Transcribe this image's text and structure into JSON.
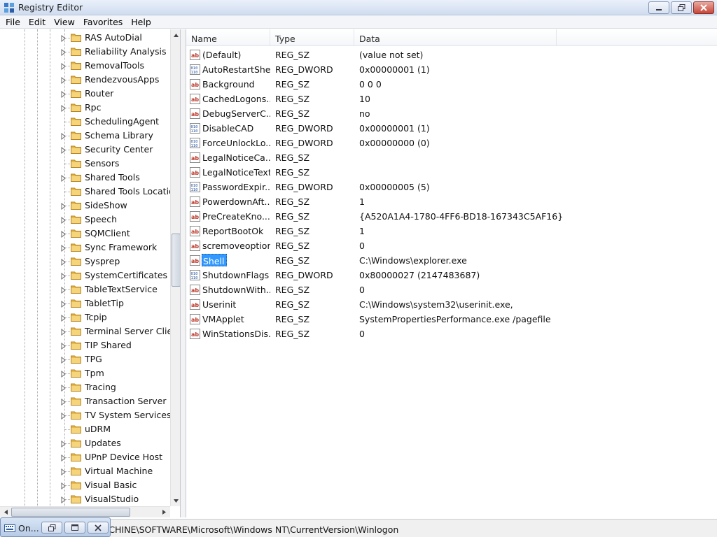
{
  "window": {
    "title": "Registry Editor"
  },
  "menu": [
    "File",
    "Edit",
    "View",
    "Favorites",
    "Help"
  ],
  "tree": {
    "items": [
      {
        "label": "RAS AutoDial",
        "expandable": true
      },
      {
        "label": "Reliability Analysis",
        "expandable": true
      },
      {
        "label": "RemovalTools",
        "expandable": true
      },
      {
        "label": "RendezvousApps",
        "expandable": true
      },
      {
        "label": "Router",
        "expandable": true
      },
      {
        "label": "Rpc",
        "expandable": true
      },
      {
        "label": "SchedulingAgent",
        "expandable": false
      },
      {
        "label": "Schema Library",
        "expandable": true
      },
      {
        "label": "Security Center",
        "expandable": true
      },
      {
        "label": "Sensors",
        "expandable": false
      },
      {
        "label": "Shared Tools",
        "expandable": true
      },
      {
        "label": "Shared Tools Locatio",
        "expandable": false
      },
      {
        "label": "SideShow",
        "expandable": true
      },
      {
        "label": "Speech",
        "expandable": true
      },
      {
        "label": "SQMClient",
        "expandable": true
      },
      {
        "label": "Sync Framework",
        "expandable": true
      },
      {
        "label": "Sysprep",
        "expandable": true
      },
      {
        "label": "SystemCertificates",
        "expandable": true
      },
      {
        "label": "TableTextService",
        "expandable": true
      },
      {
        "label": "TabletTip",
        "expandable": true
      },
      {
        "label": "Tcpip",
        "expandable": true
      },
      {
        "label": "Terminal Server Clier",
        "expandable": true
      },
      {
        "label": "TIP Shared",
        "expandable": true
      },
      {
        "label": "TPG",
        "expandable": true
      },
      {
        "label": "Tpm",
        "expandable": true
      },
      {
        "label": "Tracing",
        "expandable": true
      },
      {
        "label": "Transaction Server",
        "expandable": true
      },
      {
        "label": "TV System Services",
        "expandable": true
      },
      {
        "label": "uDRM",
        "expandable": false
      },
      {
        "label": "Updates",
        "expandable": true
      },
      {
        "label": "UPnP Device Host",
        "expandable": true
      },
      {
        "label": "Virtual Machine",
        "expandable": true
      },
      {
        "label": "Visual Basic",
        "expandable": true
      },
      {
        "label": "VisualStudio",
        "expandable": true
      }
    ]
  },
  "list": {
    "columns": [
      "Name",
      "Type",
      "Data"
    ],
    "rows": [
      {
        "icon": "string-value-icon",
        "name": "(Default)",
        "type": "REG_SZ",
        "data": "(value not set)"
      },
      {
        "icon": "binary-value-icon",
        "name": "AutoRestartShell",
        "type": "REG_DWORD",
        "data": "0x00000001 (1)"
      },
      {
        "icon": "string-value-icon",
        "name": "Background",
        "type": "REG_SZ",
        "data": "0 0 0"
      },
      {
        "icon": "string-value-icon",
        "name": "CachedLogons...",
        "type": "REG_SZ",
        "data": "10"
      },
      {
        "icon": "string-value-icon",
        "name": "DebugServerC...",
        "type": "REG_SZ",
        "data": "no"
      },
      {
        "icon": "binary-value-icon",
        "name": "DisableCAD",
        "type": "REG_DWORD",
        "data": "0x00000001 (1)"
      },
      {
        "icon": "binary-value-icon",
        "name": "ForceUnlockLo...",
        "type": "REG_DWORD",
        "data": "0x00000000 (0)"
      },
      {
        "icon": "string-value-icon",
        "name": "LegalNoticeCa...",
        "type": "REG_SZ",
        "data": ""
      },
      {
        "icon": "string-value-icon",
        "name": "LegalNoticeText",
        "type": "REG_SZ",
        "data": ""
      },
      {
        "icon": "binary-value-icon",
        "name": "PasswordExpir...",
        "type": "REG_DWORD",
        "data": "0x00000005 (5)"
      },
      {
        "icon": "string-value-icon",
        "name": "PowerdownAft...",
        "type": "REG_SZ",
        "data": "1"
      },
      {
        "icon": "string-value-icon",
        "name": "PreCreateKno...",
        "type": "REG_SZ",
        "data": "{A520A1A4-1780-4FF6-BD18-167343C5AF16}"
      },
      {
        "icon": "string-value-icon",
        "name": "ReportBootOk",
        "type": "REG_SZ",
        "data": "1"
      },
      {
        "icon": "string-value-icon",
        "name": "scremoveoption",
        "type": "REG_SZ",
        "data": "0"
      },
      {
        "icon": "string-value-icon",
        "name": "Shell",
        "type": "REG_SZ",
        "data": "C:\\Windows\\explorer.exe",
        "selected": true
      },
      {
        "icon": "binary-value-icon",
        "name": "ShutdownFlags",
        "type": "REG_DWORD",
        "data": "0x80000027 (2147483687)"
      },
      {
        "icon": "string-value-icon",
        "name": "ShutdownWith...",
        "type": "REG_SZ",
        "data": "0"
      },
      {
        "icon": "string-value-icon",
        "name": "Userinit",
        "type": "REG_SZ",
        "data": "C:\\Windows\\system32\\userinit.exe,"
      },
      {
        "icon": "string-value-icon",
        "name": "VMApplet",
        "type": "REG_SZ",
        "data": "SystemPropertiesPerformance.exe /pagefile"
      },
      {
        "icon": "string-value-icon",
        "name": "WinStationsDis...",
        "type": "REG_SZ",
        "data": "0"
      }
    ]
  },
  "status": {
    "path": "ACHINE\\SOFTWARE\\Microsoft\\Windows NT\\CurrentVersion\\Winlogon"
  },
  "minimized": {
    "label": "On..."
  },
  "colors": {
    "selection": "#3399ff",
    "folder": "#e8b84a",
    "close": "#c8473a"
  }
}
